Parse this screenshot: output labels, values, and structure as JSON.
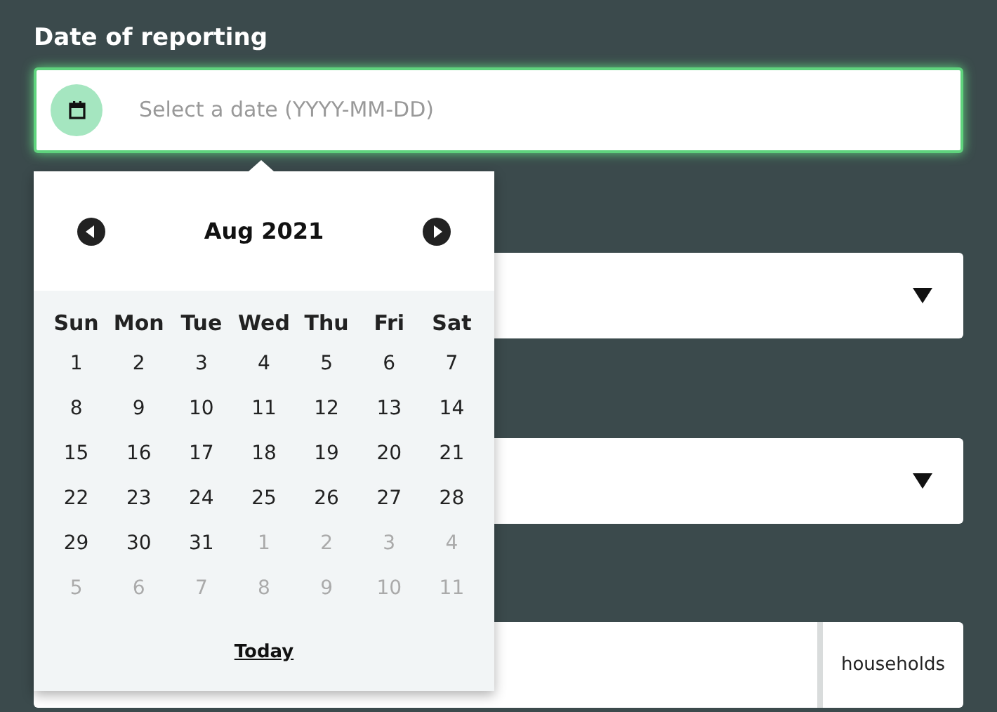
{
  "date_field": {
    "label": "Date of reporting",
    "placeholder": "Select a date (YYYY-MM-DD)",
    "focused": true
  },
  "calendar": {
    "month": "Aug 2021",
    "weekdays": [
      "Sun",
      "Mon",
      "Tue",
      "Wed",
      "Thu",
      "Fri",
      "Sat"
    ],
    "days": [
      {
        "label": "1",
        "outside": false
      },
      {
        "label": "2",
        "outside": false
      },
      {
        "label": "3",
        "outside": false
      },
      {
        "label": "4",
        "outside": false
      },
      {
        "label": "5",
        "outside": false
      },
      {
        "label": "6",
        "outside": false
      },
      {
        "label": "7",
        "outside": false
      },
      {
        "label": "8",
        "outside": false
      },
      {
        "label": "9",
        "outside": false
      },
      {
        "label": "10",
        "outside": false
      },
      {
        "label": "11",
        "outside": false
      },
      {
        "label": "12",
        "outside": false
      },
      {
        "label": "13",
        "outside": false
      },
      {
        "label": "14",
        "outside": false
      },
      {
        "label": "15",
        "outside": false
      },
      {
        "label": "16",
        "outside": false
      },
      {
        "label": "17",
        "outside": false
      },
      {
        "label": "18",
        "outside": false
      },
      {
        "label": "19",
        "outside": false
      },
      {
        "label": "20",
        "outside": false
      },
      {
        "label": "21",
        "outside": false
      },
      {
        "label": "22",
        "outside": false
      },
      {
        "label": "23",
        "outside": false
      },
      {
        "label": "24",
        "outside": false
      },
      {
        "label": "25",
        "outside": false
      },
      {
        "label": "26",
        "outside": false
      },
      {
        "label": "27",
        "outside": false
      },
      {
        "label": "28",
        "outside": false
      },
      {
        "label": "29",
        "outside": false
      },
      {
        "label": "30",
        "outside": false
      },
      {
        "label": "31",
        "outside": false
      },
      {
        "label": "1",
        "outside": true
      },
      {
        "label": "2",
        "outside": true
      },
      {
        "label": "3",
        "outside": true
      },
      {
        "label": "4",
        "outside": true
      },
      {
        "label": "5",
        "outside": true
      },
      {
        "label": "6",
        "outside": true
      },
      {
        "label": "7",
        "outside": true
      },
      {
        "label": "8",
        "outside": true
      },
      {
        "label": "9",
        "outside": true
      },
      {
        "label": "10",
        "outside": true
      },
      {
        "label": "11",
        "outside": true
      }
    ],
    "today_link": "Today"
  },
  "fields": [
    {
      "kind": "select"
    },
    {
      "kind": "select"
    },
    {
      "kind": "number",
      "unit": "households"
    }
  ]
}
